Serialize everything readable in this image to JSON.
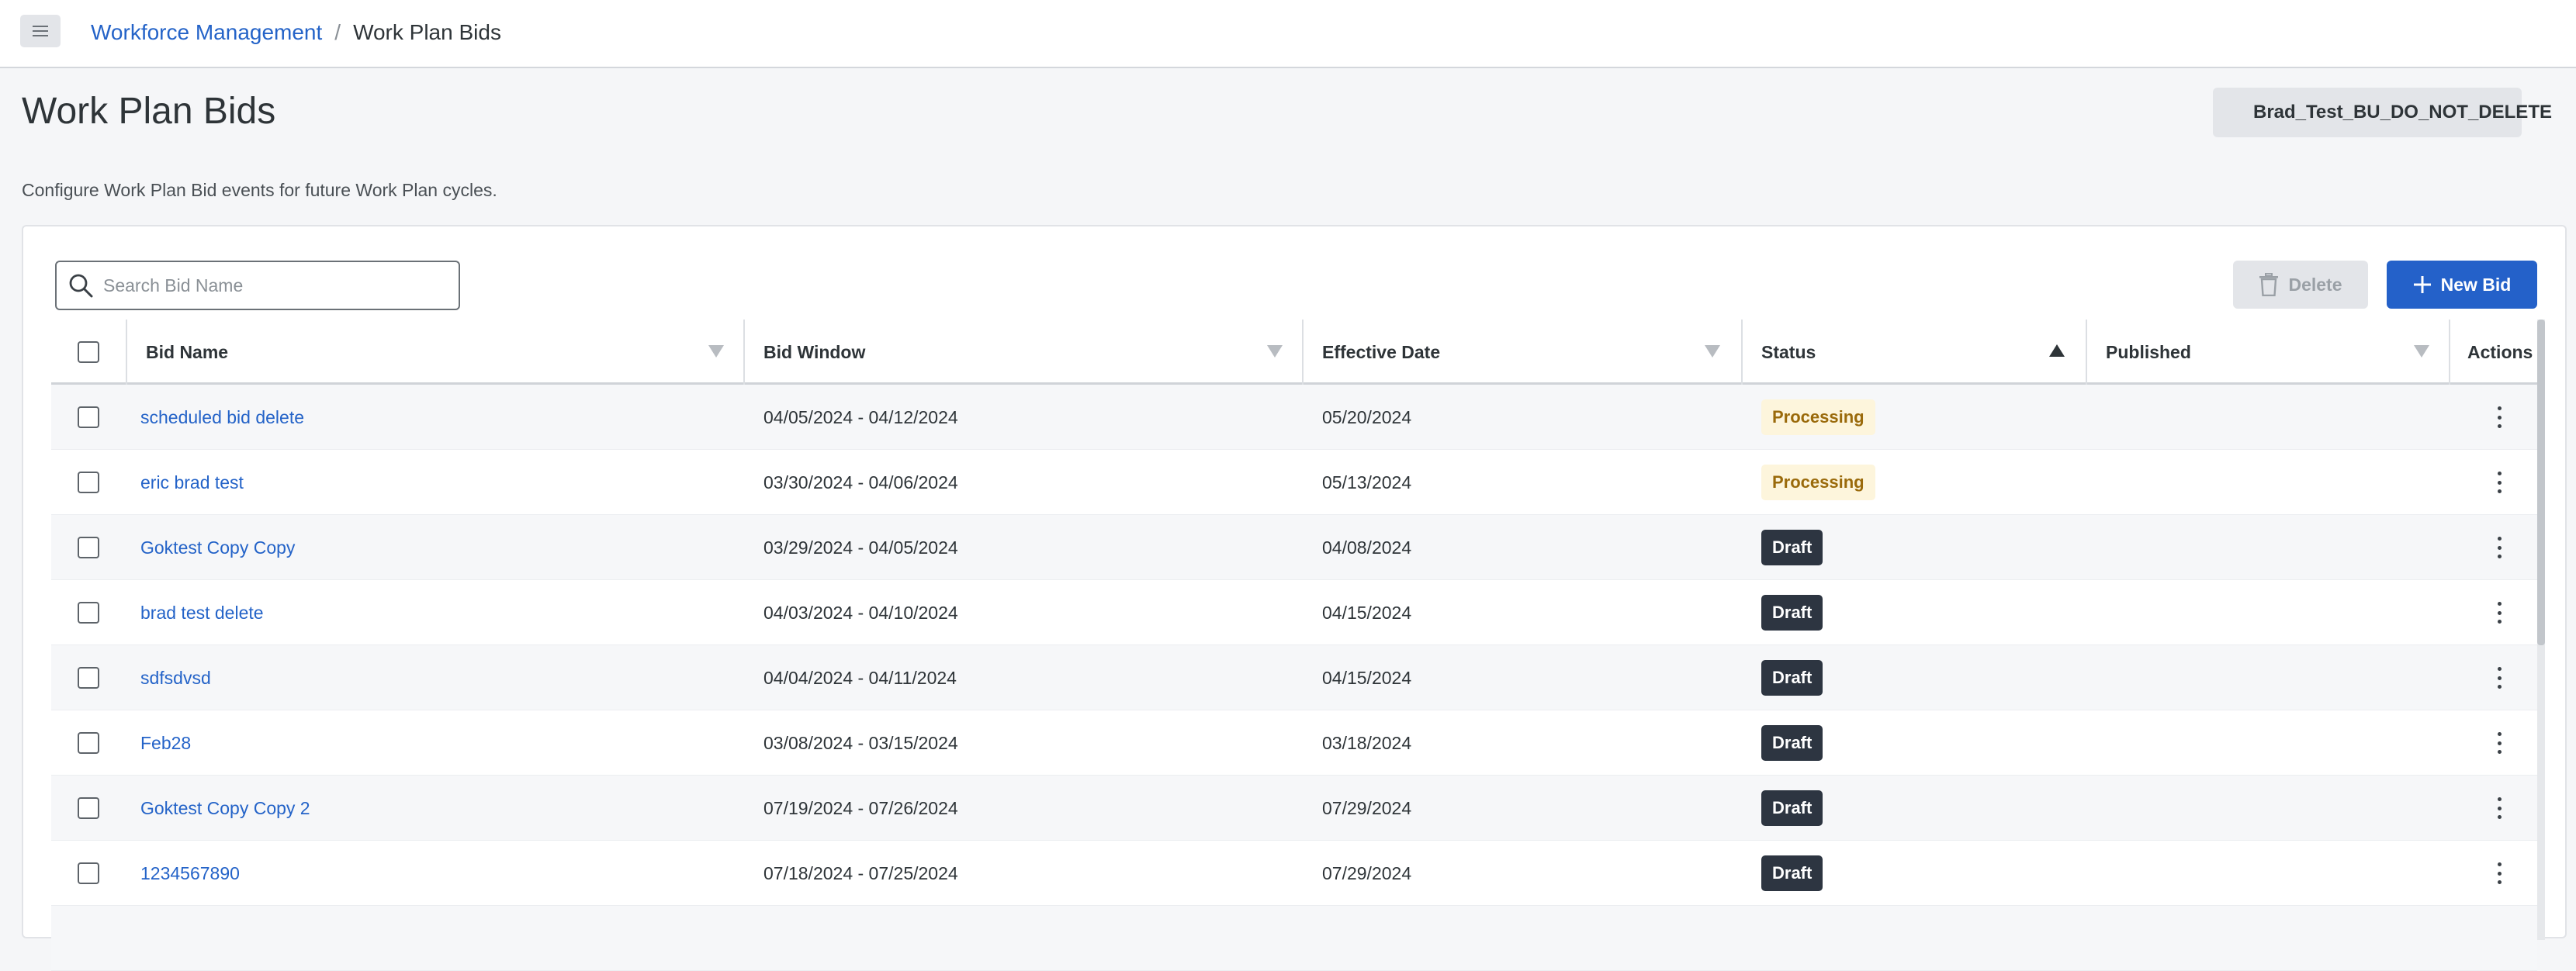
{
  "breadcrumb": {
    "parent": "Workforce Management",
    "separator": "/",
    "current": "Work Plan Bids"
  },
  "page": {
    "title": "Work Plan Bids",
    "description": "Configure Work Plan Bid events for future Work Plan cycles.",
    "business_unit": "Brad_Test_BU_DO_NOT_DELETE"
  },
  "toolbar": {
    "search_placeholder": "Search Bid Name",
    "delete_label": "Delete",
    "new_bid_label": "New Bid"
  },
  "table": {
    "columns": {
      "bid_name": "Bid Name",
      "bid_window": "Bid Window",
      "effective_date": "Effective Date",
      "status": "Status",
      "published": "Published",
      "actions": "Actions"
    },
    "sorted_column": "status",
    "sort_direction": "ascending",
    "rows": [
      {
        "bid_name": "scheduled bid delete",
        "bid_window": "04/05/2024 - 04/12/2024",
        "effective_date": "05/20/2024",
        "status": "Processing",
        "published": ""
      },
      {
        "bid_name": "eric brad test",
        "bid_window": "03/30/2024 - 04/06/2024",
        "effective_date": "05/13/2024",
        "status": "Processing",
        "published": ""
      },
      {
        "bid_name": "Goktest Copy Copy",
        "bid_window": "03/29/2024 - 04/05/2024",
        "effective_date": "04/08/2024",
        "status": "Draft",
        "published": ""
      },
      {
        "bid_name": "brad test delete",
        "bid_window": "04/03/2024 - 04/10/2024",
        "effective_date": "04/15/2024",
        "status": "Draft",
        "published": ""
      },
      {
        "bid_name": "sdfsdvsd",
        "bid_window": "04/04/2024 - 04/11/2024",
        "effective_date": "04/15/2024",
        "status": "Draft",
        "published": ""
      },
      {
        "bid_name": "Feb28",
        "bid_window": "03/08/2024 - 03/15/2024",
        "effective_date": "03/18/2024",
        "status": "Draft",
        "published": ""
      },
      {
        "bid_name": "Goktest Copy Copy 2",
        "bid_window": "07/19/2024 - 07/26/2024",
        "effective_date": "07/29/2024",
        "status": "Draft",
        "published": ""
      },
      {
        "bid_name": "1234567890",
        "bid_window": "07/18/2024 - 07/25/2024",
        "effective_date": "07/29/2024",
        "status": "Draft",
        "published": ""
      }
    ]
  },
  "colors": {
    "link": "#2463c8",
    "primary_button": "#2461c9",
    "processing_bg": "#fdf5dc",
    "processing_text": "#9a6a0b",
    "draft_bg": "#2d3541"
  },
  "icons": {
    "menu": "hamburger-menu-icon",
    "business_unit": "building-icon",
    "search": "search-icon",
    "delete": "trash-icon",
    "new": "plus-icon",
    "filter": "filter-triangle-icon",
    "sort": "sort-ascending-icon",
    "actions": "kebab-menu-icon"
  }
}
